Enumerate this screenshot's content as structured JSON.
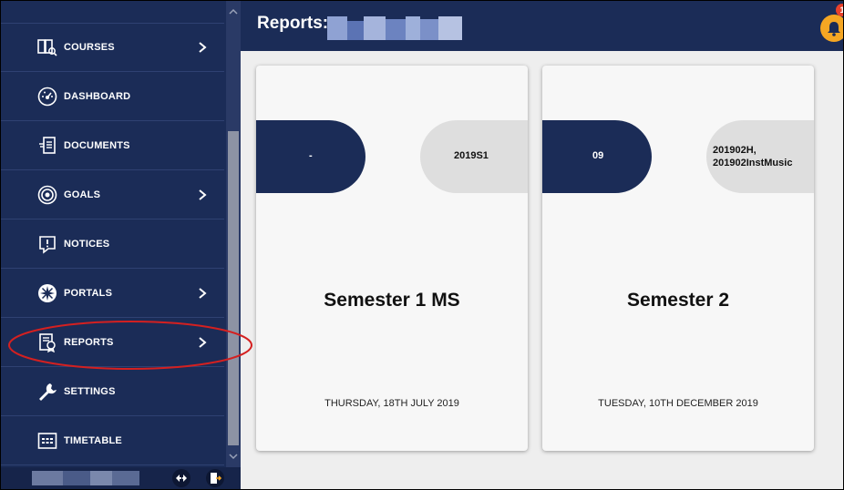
{
  "sidebar": {
    "items": [
      {
        "label": "COURSES",
        "icon": "courses-icon",
        "has_chevron": true
      },
      {
        "label": "DASHBOARD",
        "icon": "dashboard-icon",
        "has_chevron": false
      },
      {
        "label": "DOCUMENTS",
        "icon": "documents-icon",
        "has_chevron": false
      },
      {
        "label": "GOALS",
        "icon": "target-icon",
        "has_chevron": true
      },
      {
        "label": "NOTICES",
        "icon": "notice-icon",
        "has_chevron": false
      },
      {
        "label": "PORTALS",
        "icon": "portals-icon",
        "has_chevron": true
      },
      {
        "label": "REPORTS",
        "icon": "reports-icon",
        "has_chevron": true
      },
      {
        "label": "SETTINGS",
        "icon": "wrench-icon",
        "has_chevron": false
      },
      {
        "label": "TIMETABLE",
        "icon": "timetable-icon",
        "has_chevron": false
      }
    ],
    "footer_icons": [
      "swap-icon",
      "logout-icon"
    ]
  },
  "header": {
    "title": "Reports:",
    "notification_count": "1"
  },
  "cards": [
    {
      "left_pill": "-",
      "right_pill_lines": [
        "2019S1"
      ],
      "title": "Semester 1 MS",
      "date": "THURSDAY, 18TH JULY 2019"
    },
    {
      "left_pill": "09",
      "right_pill_lines": [
        "201902H,",
        "201902InstMusic"
      ],
      "title": "Semester 2",
      "date": "TUESDAY, 10TH DECEMBER 2019"
    }
  ],
  "colors": {
    "navy": "#1b2c57",
    "accent_bell": "#f5a623",
    "highlight": "#d42020"
  }
}
